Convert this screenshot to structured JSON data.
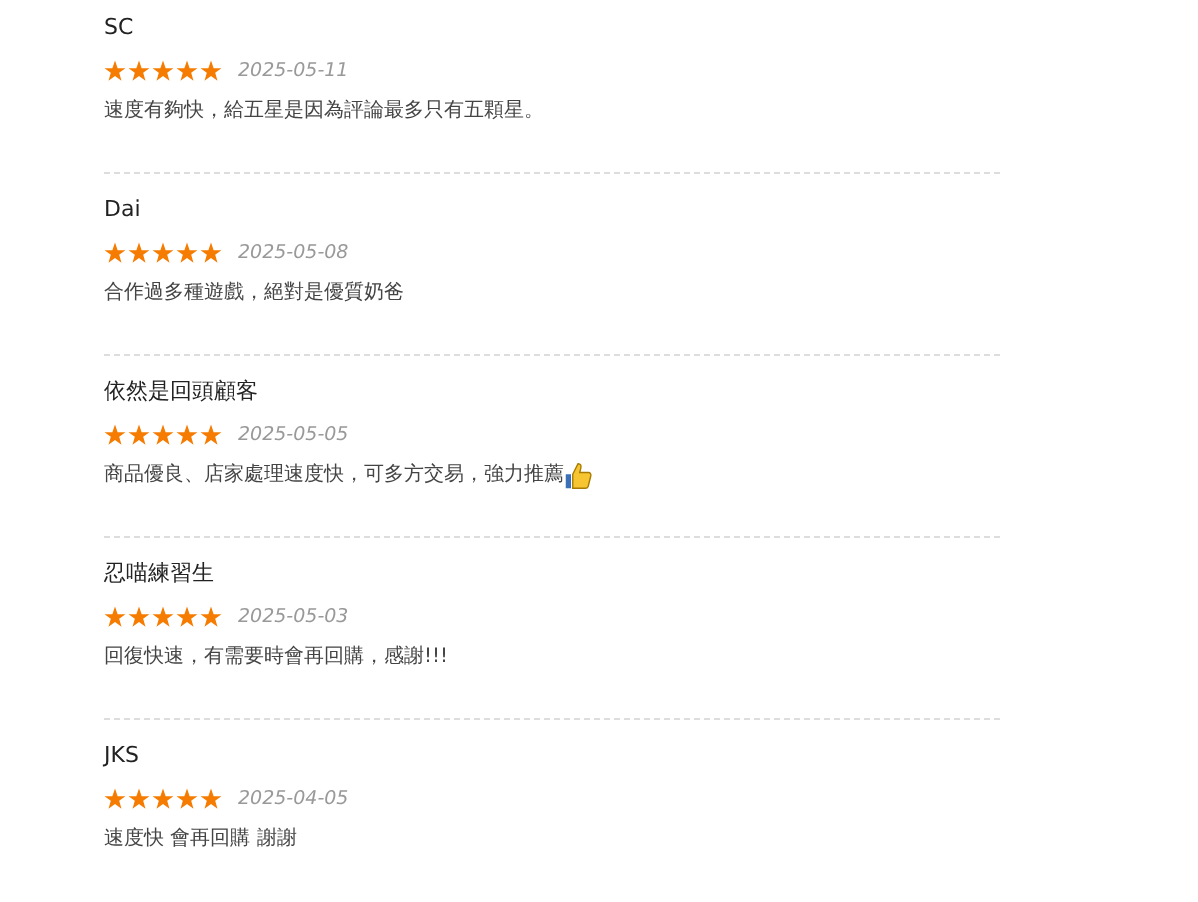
{
  "reviews": [
    {
      "name": "SC",
      "stars": 5,
      "date": "2025-05-11",
      "comment": "速度有夠快，給五星是因為評論最多只有五顆星。",
      "thumbs_up": false
    },
    {
      "name": "Dai",
      "stars": 5,
      "date": "2025-05-08",
      "comment": "合作過多種遊戲，絕對是優質奶爸",
      "thumbs_up": false
    },
    {
      "name": "依然是回頭顧客",
      "stars": 5,
      "date": "2025-05-05",
      "comment": "商品優良、店家處理速度快，可多方交易，強力推薦",
      "thumbs_up": true
    },
    {
      "name": "忍喵練習生",
      "stars": 5,
      "date": "2025-05-03",
      "comment": "回復快速，有需要時會再回購，感謝!!!",
      "thumbs_up": false
    },
    {
      "name": "JKS",
      "stars": 5,
      "date": "2025-04-05",
      "comment": "速度快 會再回購 謝謝",
      "thumbs_up": false
    }
  ]
}
